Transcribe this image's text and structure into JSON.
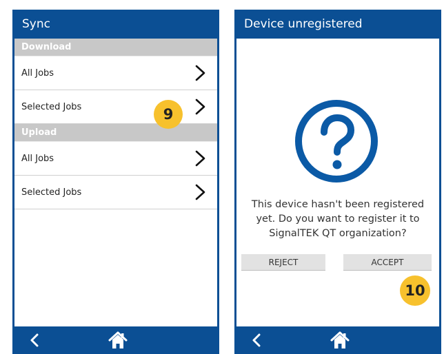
{
  "left_screen": {
    "title": "Sync",
    "sections": [
      {
        "header": "Download",
        "items": [
          {
            "label": "All Jobs"
          },
          {
            "label": "Selected Jobs"
          }
        ]
      },
      {
        "header": "Upload",
        "items": [
          {
            "label": "All Jobs"
          },
          {
            "label": "Selected Jobs"
          }
        ]
      }
    ],
    "callout": "9"
  },
  "right_screen": {
    "title": "Device unregistered",
    "message": "This device hasn't been registered yet. Do you want to register it to SignalTEK QT organization?",
    "reject_label": "REJECT",
    "accept_label": "ACCEPT",
    "callout": "10"
  },
  "colors": {
    "brand_blue": "#0b4f94",
    "section_grey": "#c8c8c8",
    "callout_yellow": "#f7c12d"
  },
  "icons": {
    "row_chevron": "chevron-right-icon",
    "back": "back-arrow-icon",
    "home": "home-icon",
    "dialog": "question-mark-circle-icon"
  }
}
